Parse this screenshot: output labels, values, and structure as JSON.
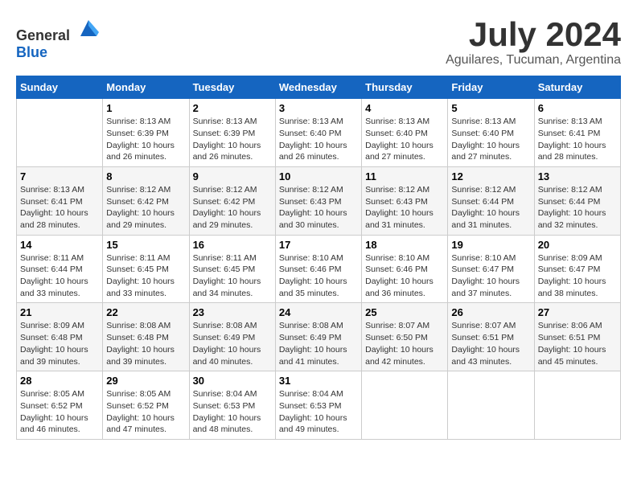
{
  "logo": {
    "text_general": "General",
    "text_blue": "Blue"
  },
  "title": {
    "month_year": "July 2024",
    "location": "Aguilares, Tucuman, Argentina"
  },
  "days_of_week": [
    "Sunday",
    "Monday",
    "Tuesday",
    "Wednesday",
    "Thursday",
    "Friday",
    "Saturday"
  ],
  "weeks": [
    [
      {
        "day": "",
        "info": ""
      },
      {
        "day": "1",
        "info": "Sunrise: 8:13 AM\nSunset: 6:39 PM\nDaylight: 10 hours\nand 26 minutes."
      },
      {
        "day": "2",
        "info": "Sunrise: 8:13 AM\nSunset: 6:39 PM\nDaylight: 10 hours\nand 26 minutes."
      },
      {
        "day": "3",
        "info": "Sunrise: 8:13 AM\nSunset: 6:40 PM\nDaylight: 10 hours\nand 26 minutes."
      },
      {
        "day": "4",
        "info": "Sunrise: 8:13 AM\nSunset: 6:40 PM\nDaylight: 10 hours\nand 27 minutes."
      },
      {
        "day": "5",
        "info": "Sunrise: 8:13 AM\nSunset: 6:40 PM\nDaylight: 10 hours\nand 27 minutes."
      },
      {
        "day": "6",
        "info": "Sunrise: 8:13 AM\nSunset: 6:41 PM\nDaylight: 10 hours\nand 28 minutes."
      }
    ],
    [
      {
        "day": "7",
        "info": "Sunrise: 8:13 AM\nSunset: 6:41 PM\nDaylight: 10 hours\nand 28 minutes."
      },
      {
        "day": "8",
        "info": "Sunrise: 8:12 AM\nSunset: 6:42 PM\nDaylight: 10 hours\nand 29 minutes."
      },
      {
        "day": "9",
        "info": "Sunrise: 8:12 AM\nSunset: 6:42 PM\nDaylight: 10 hours\nand 29 minutes."
      },
      {
        "day": "10",
        "info": "Sunrise: 8:12 AM\nSunset: 6:43 PM\nDaylight: 10 hours\nand 30 minutes."
      },
      {
        "day": "11",
        "info": "Sunrise: 8:12 AM\nSunset: 6:43 PM\nDaylight: 10 hours\nand 31 minutes."
      },
      {
        "day": "12",
        "info": "Sunrise: 8:12 AM\nSunset: 6:44 PM\nDaylight: 10 hours\nand 31 minutes."
      },
      {
        "day": "13",
        "info": "Sunrise: 8:12 AM\nSunset: 6:44 PM\nDaylight: 10 hours\nand 32 minutes."
      }
    ],
    [
      {
        "day": "14",
        "info": "Sunrise: 8:11 AM\nSunset: 6:44 PM\nDaylight: 10 hours\nand 33 minutes."
      },
      {
        "day": "15",
        "info": "Sunrise: 8:11 AM\nSunset: 6:45 PM\nDaylight: 10 hours\nand 33 minutes."
      },
      {
        "day": "16",
        "info": "Sunrise: 8:11 AM\nSunset: 6:45 PM\nDaylight: 10 hours\nand 34 minutes."
      },
      {
        "day": "17",
        "info": "Sunrise: 8:10 AM\nSunset: 6:46 PM\nDaylight: 10 hours\nand 35 minutes."
      },
      {
        "day": "18",
        "info": "Sunrise: 8:10 AM\nSunset: 6:46 PM\nDaylight: 10 hours\nand 36 minutes."
      },
      {
        "day": "19",
        "info": "Sunrise: 8:10 AM\nSunset: 6:47 PM\nDaylight: 10 hours\nand 37 minutes."
      },
      {
        "day": "20",
        "info": "Sunrise: 8:09 AM\nSunset: 6:47 PM\nDaylight: 10 hours\nand 38 minutes."
      }
    ],
    [
      {
        "day": "21",
        "info": "Sunrise: 8:09 AM\nSunset: 6:48 PM\nDaylight: 10 hours\nand 39 minutes."
      },
      {
        "day": "22",
        "info": "Sunrise: 8:08 AM\nSunset: 6:48 PM\nDaylight: 10 hours\nand 39 minutes."
      },
      {
        "day": "23",
        "info": "Sunrise: 8:08 AM\nSunset: 6:49 PM\nDaylight: 10 hours\nand 40 minutes."
      },
      {
        "day": "24",
        "info": "Sunrise: 8:08 AM\nSunset: 6:49 PM\nDaylight: 10 hours\nand 41 minutes."
      },
      {
        "day": "25",
        "info": "Sunrise: 8:07 AM\nSunset: 6:50 PM\nDaylight: 10 hours\nand 42 minutes."
      },
      {
        "day": "26",
        "info": "Sunrise: 8:07 AM\nSunset: 6:51 PM\nDaylight: 10 hours\nand 43 minutes."
      },
      {
        "day": "27",
        "info": "Sunrise: 8:06 AM\nSunset: 6:51 PM\nDaylight: 10 hours\nand 45 minutes."
      }
    ],
    [
      {
        "day": "28",
        "info": "Sunrise: 8:05 AM\nSunset: 6:52 PM\nDaylight: 10 hours\nand 46 minutes."
      },
      {
        "day": "29",
        "info": "Sunrise: 8:05 AM\nSunset: 6:52 PM\nDaylight: 10 hours\nand 47 minutes."
      },
      {
        "day": "30",
        "info": "Sunrise: 8:04 AM\nSunset: 6:53 PM\nDaylight: 10 hours\nand 48 minutes."
      },
      {
        "day": "31",
        "info": "Sunrise: 8:04 AM\nSunset: 6:53 PM\nDaylight: 10 hours\nand 49 minutes."
      },
      {
        "day": "",
        "info": ""
      },
      {
        "day": "",
        "info": ""
      },
      {
        "day": "",
        "info": ""
      }
    ]
  ]
}
